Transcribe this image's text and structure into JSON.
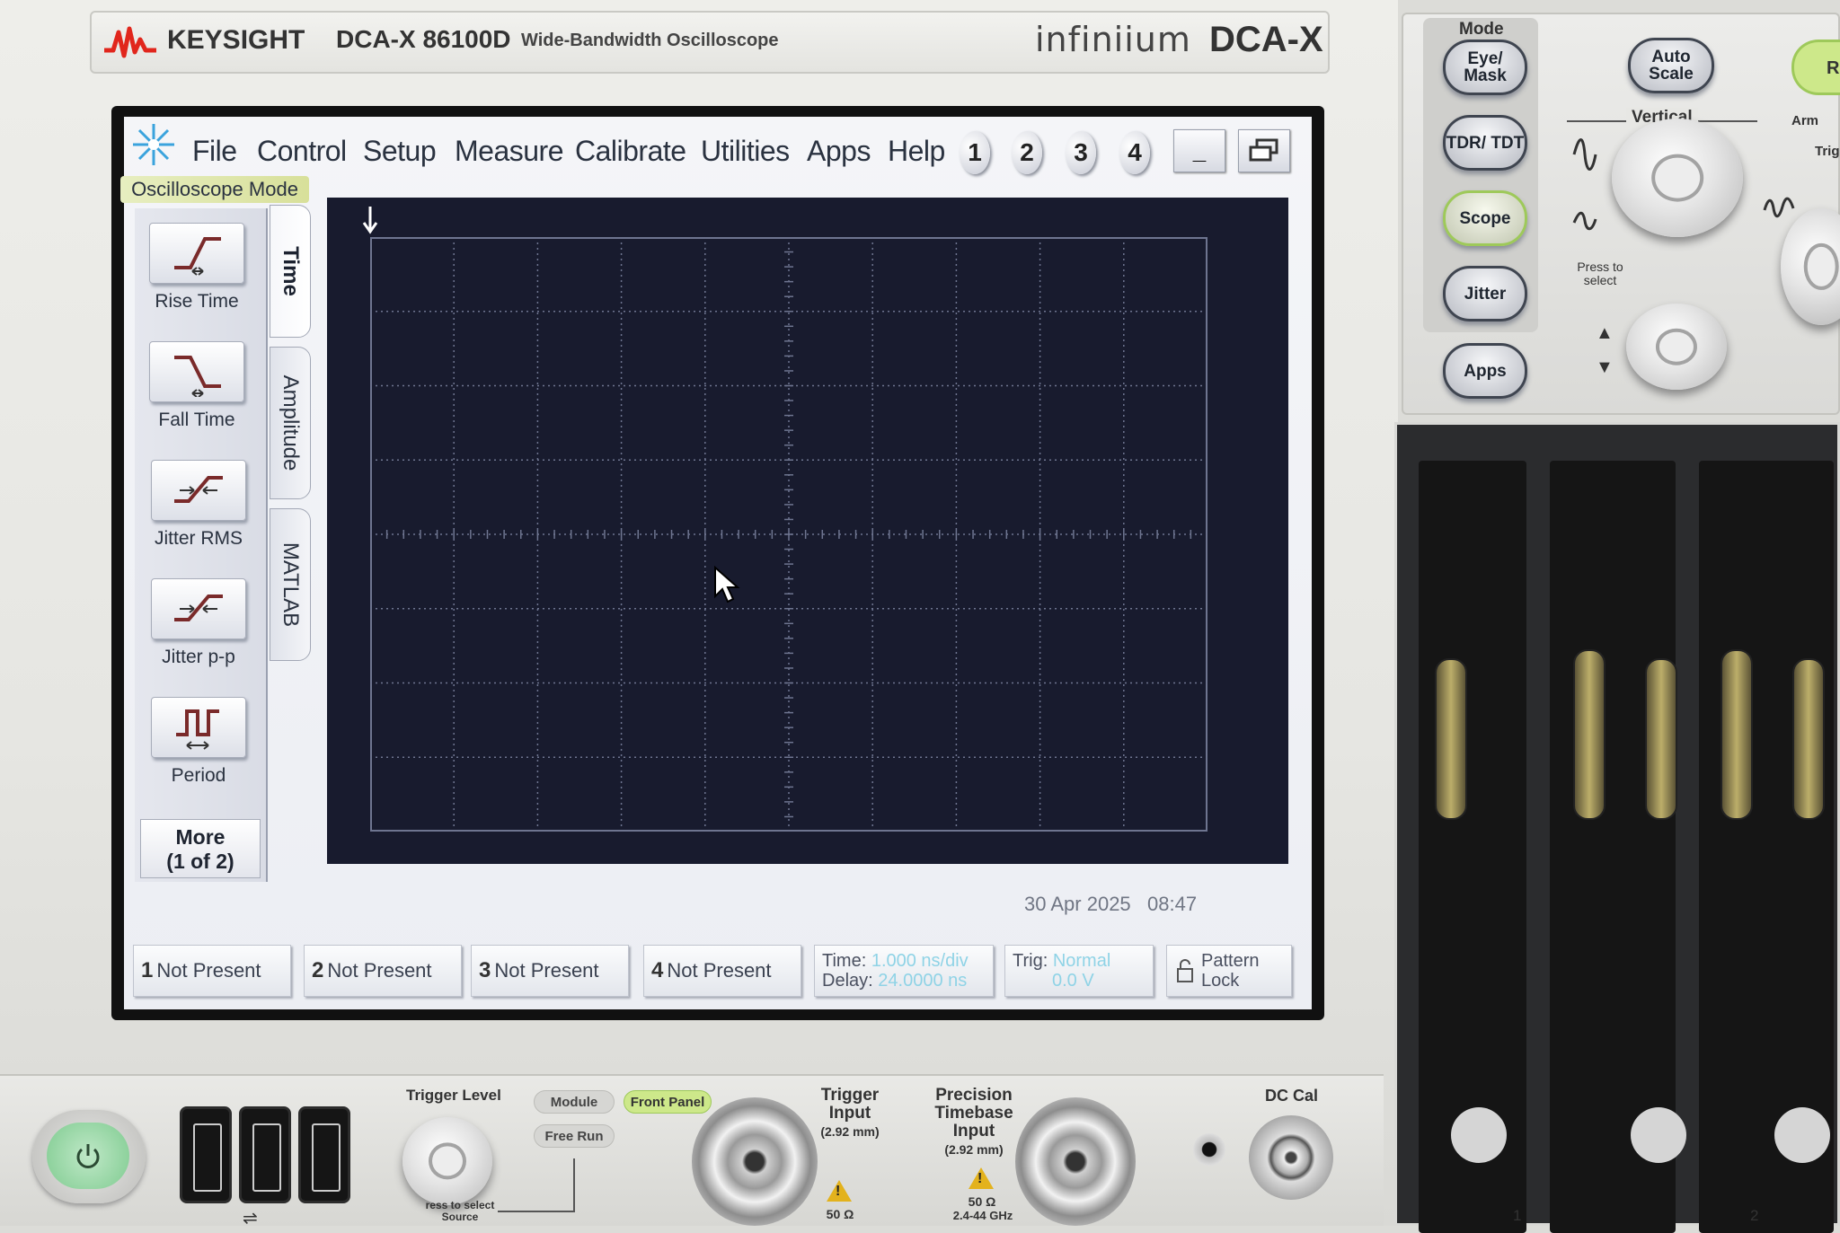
{
  "header": {
    "brand": "KEYSIGHT",
    "model": "DCA-X 86100D",
    "subtitle": "Wide-Bandwidth Oscilloscope",
    "product_script": "infiniium",
    "product_name": "DCA-X"
  },
  "menubar": {
    "items": [
      "File",
      "Control",
      "Setup",
      "Measure",
      "Calibrate",
      "Utilities",
      "Apps",
      "Help"
    ],
    "channel_buttons": [
      "1",
      "2",
      "3",
      "4"
    ],
    "minimize_label": "_",
    "restore_icon": "restore-window-icon"
  },
  "mode_label": "Oscilloscope Mode",
  "measure_tabs": {
    "active": "Time",
    "tabs": [
      "Time",
      "Amplitude",
      "MATLAB"
    ]
  },
  "measurements": [
    {
      "label": "Rise Time",
      "icon": "rise-time-icon"
    },
    {
      "label": "Fall Time",
      "icon": "fall-time-icon"
    },
    {
      "label": "Jitter RMS",
      "icon": "jitter-rms-icon"
    },
    {
      "label": "Jitter p-p",
      "icon": "jitter-pp-icon"
    },
    {
      "label": "Period",
      "icon": "period-icon"
    }
  ],
  "more_button": {
    "line1": "More",
    "line2": "(1 of 2)"
  },
  "graticule": {
    "h_divisions": 10,
    "v_divisions": 8,
    "background": "#181b2e",
    "grid_color": "#6e7590"
  },
  "timestamp": {
    "date": "30 Apr 2025",
    "time": "08:47"
  },
  "status_bar": {
    "channels": [
      {
        "num": "1",
        "label": "Not Present"
      },
      {
        "num": "2",
        "label": "Not Present"
      },
      {
        "num": "3",
        "label": "Not Present"
      },
      {
        "num": "4",
        "label": "Not Present"
      }
    ],
    "timebase": {
      "time_label": "Time:",
      "time_value": "1.000 ns/div",
      "delay_label": "Delay:",
      "delay_value": "24.0000 ns"
    },
    "trigger": {
      "label": "Trig:",
      "mode": "Normal",
      "level": "0.0 V"
    },
    "pattern_lock": {
      "line1": "Pattern",
      "line2": "Lock"
    }
  },
  "control_panel": {
    "mode_title": "Mode",
    "mode_buttons": [
      "Eye/ Mask",
      "TDR/ TDT",
      "Scope",
      "Jitter",
      "Apps"
    ],
    "active_mode": "Scope",
    "auto_scale": "Auto Scale",
    "vertical_label": "Vertical",
    "press_to_select": "Press to select",
    "partial_labels": {
      "button": "R",
      "arm": "Arm",
      "trig": "Trig"
    },
    "accent_color": "#cde88a"
  },
  "front_panel": {
    "trigger_level": "Trigger Level",
    "press_source": "ress to select Source",
    "trigger_source_buttons": [
      "Module",
      "Front Panel",
      "Free Run"
    ],
    "active_source": "Front Panel",
    "trigger_input": {
      "title": "Trigger Input",
      "spec": "(2.92 mm)",
      "impedance": "50 Ω"
    },
    "precision_input": {
      "title": "Precision Timebase Input",
      "spec": "(2.92 mm)",
      "impedance": "50 Ω",
      "range": "2.4-44 GHz"
    },
    "dc_cal": "DC Cal",
    "bay_numbers": [
      "1",
      "2"
    ]
  }
}
